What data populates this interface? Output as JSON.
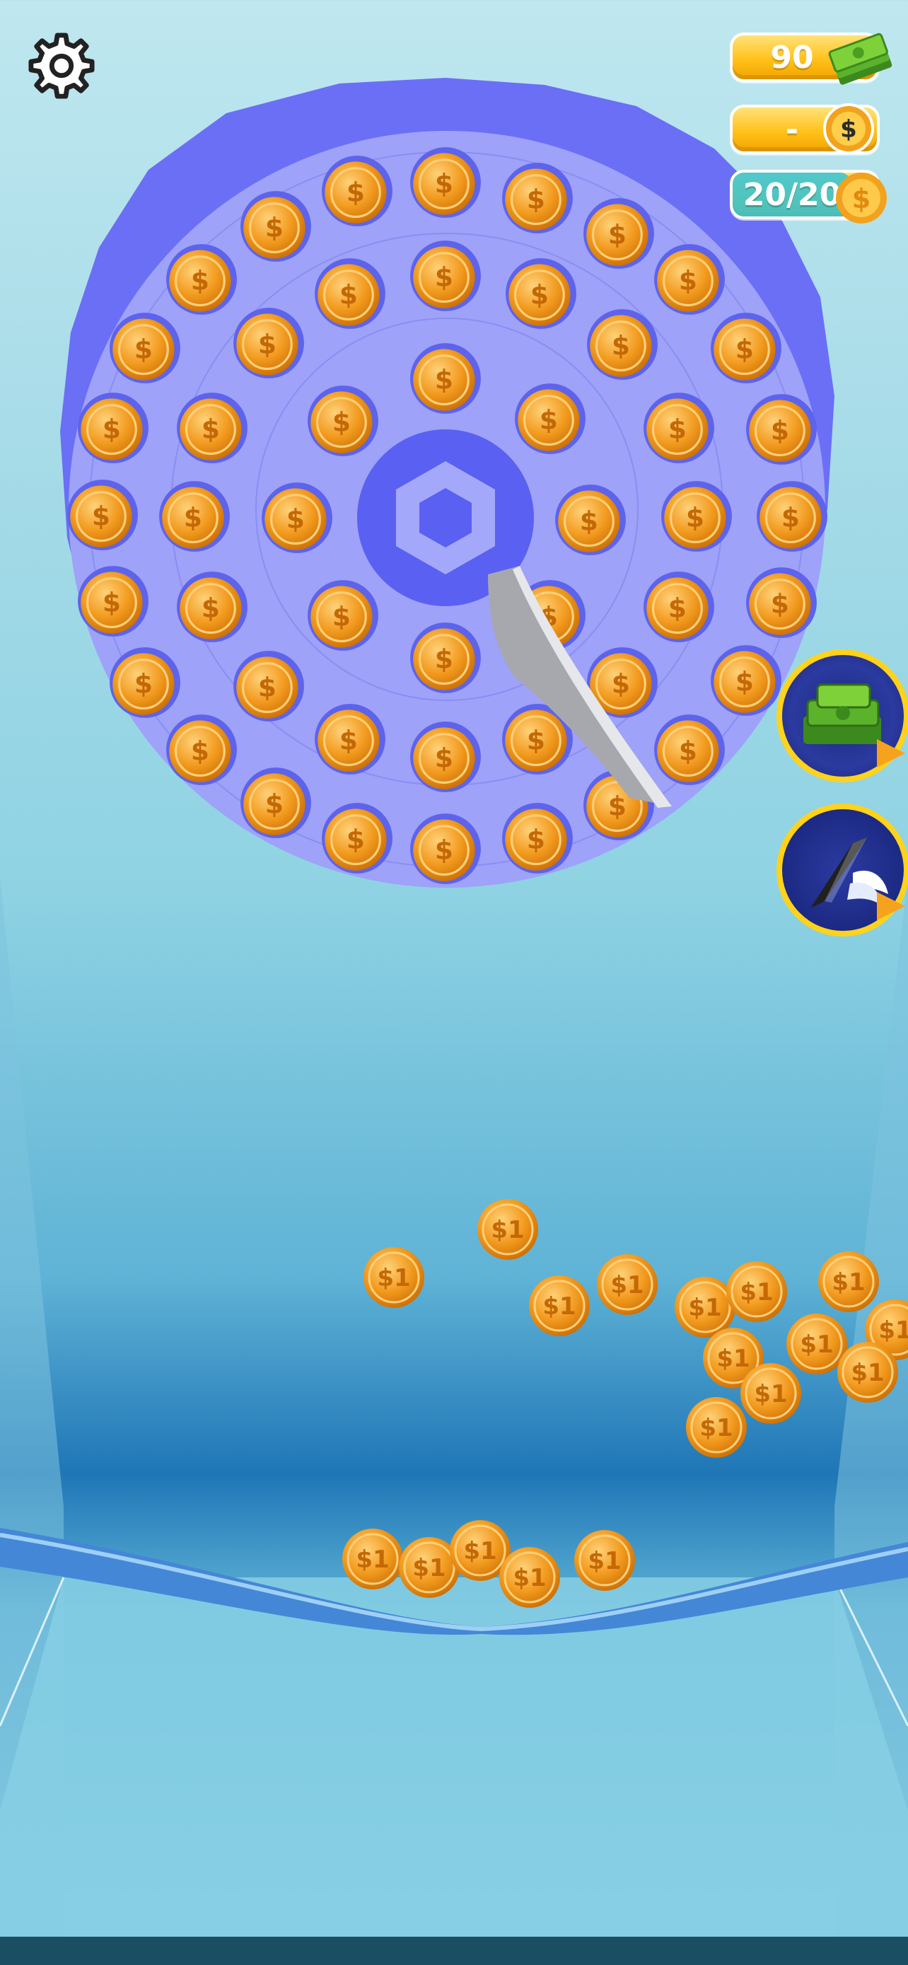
{
  "hud": {
    "cash": "90",
    "coin_rate": "-",
    "coins_capacity": "20/20",
    "cash_icon": "cash-stack-icon",
    "rate_icon": "coin-stack-icon",
    "capacity_icon": "dollar-coin-icon"
  },
  "buttons": {
    "settings_icon": "gear-icon",
    "cash_boost_icon": "cash-pile-icon",
    "knife_boost_icon": "winged-knife-icon"
  },
  "coin_label": "$1",
  "colors": {
    "board_outer": "#6a6ff6",
    "board_inner": "#9e9ff7",
    "coin_orange": "#f29a1e",
    "pill_yellow": "#ffc21a",
    "rope_blue": "#3f7ed2"
  }
}
